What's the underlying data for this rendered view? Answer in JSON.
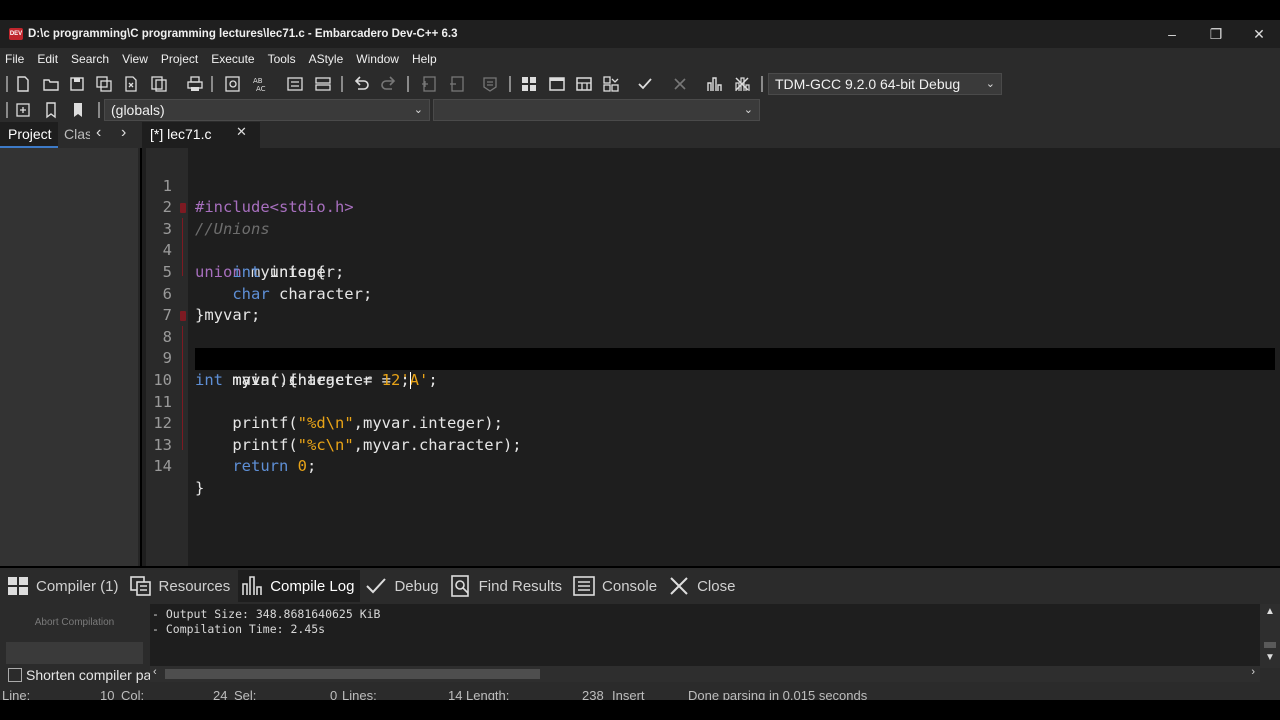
{
  "window": {
    "title": "D:\\c programming\\C programming lectures\\lec71.c - Embarcadero Dev-C++ 6.3",
    "app_icon_text": "DEV",
    "controls": {
      "minimize": "–",
      "maximize": "❐",
      "close": "✕"
    }
  },
  "menu": [
    "File",
    "Edit",
    "Search",
    "View",
    "Project",
    "Execute",
    "Tools",
    "AStyle",
    "Window",
    "Help"
  ],
  "toolbar": {
    "compiler_select": "TDM-GCC 9.2.0 64-bit Debug",
    "scope_select": "(globals)",
    "function_select": ""
  },
  "left_panel": {
    "tabs": [
      "Project",
      "Classes"
    ],
    "nav_prev": "‹",
    "nav_next": "›"
  },
  "editor": {
    "tab_label": "[*] lec71.c",
    "tab_close": "✕",
    "active_line": 10,
    "lines": [
      {
        "n": "1"
      },
      {
        "n": "2"
      },
      {
        "n": "3"
      },
      {
        "n": "4"
      },
      {
        "n": "5"
      },
      {
        "n": "6"
      },
      {
        "n": "7"
      },
      {
        "n": "8"
      },
      {
        "n": "9"
      },
      {
        "n": "10"
      },
      {
        "n": "11"
      },
      {
        "n": "12"
      },
      {
        "n": "13"
      },
      {
        "n": "14"
      }
    ],
    "code": {
      "l1": "#include<stdio.h>",
      "l2": "//Unions",
      "l3_kw": "union",
      "l3_rest": " myunion{",
      "l4_type": "int",
      "l4_rest": " integer;",
      "l5_type": "char",
      "l5_rest": " character;",
      "l6": "}myvar;",
      "l8_type": "int",
      "l8_rest": " main(){",
      "l9_a": "myvar.character = ",
      "l9_str": "'A'",
      "l9_b": ";",
      "l10_a": "myvar.integer = ",
      "l10_num": "12",
      "l10_b": ";",
      "l11_a": "printf(",
      "l11_str": "\"%d\\n\"",
      "l11_b": ",myvar.integer);",
      "l12_a": "printf(",
      "l12_str": "\"%c\\n\"",
      "l12_b": ",myvar.character);",
      "l13_kw": "return",
      "l13_num": "0",
      "l13_b": ";",
      "l14": "}"
    }
  },
  "bottom_tabs": [
    {
      "label": "Compiler (1)",
      "icon": "grid-icon"
    },
    {
      "label": "Resources",
      "icon": "resources-icon"
    },
    {
      "label": "Compile Log",
      "icon": "chart-icon"
    },
    {
      "label": "Debug",
      "icon": "check-icon"
    },
    {
      "label": "Find Results",
      "icon": "find-icon"
    },
    {
      "label": "Console",
      "icon": "console-icon"
    },
    {
      "label": "Close",
      "icon": "close-icon"
    }
  ],
  "bottom_panel": {
    "abort_label": "Abort Compilation",
    "shorten_label": "Shorten compiler paths",
    "log_lines": [
      "- Output Size: 348.8681640625 KiB",
      "- Compilation Time: 2.45s"
    ]
  },
  "status": {
    "line": "Line:",
    "line_val": "10",
    "col": "Col:",
    "col_val": "24",
    "sel": "Sel:",
    "sel_val": "0",
    "lines": "Lines:",
    "lines_val": "14",
    "length": "Length:",
    "length_val": "238",
    "mode": "Insert",
    "message": "Done parsing in 0.015 seconds"
  },
  "colors": {
    "editor_bg": "#1e1e1e",
    "preprocessor": "#a76fbe",
    "type": "#5e8fd6",
    "string": "#e8a317",
    "comment": "#6d6d6d"
  }
}
